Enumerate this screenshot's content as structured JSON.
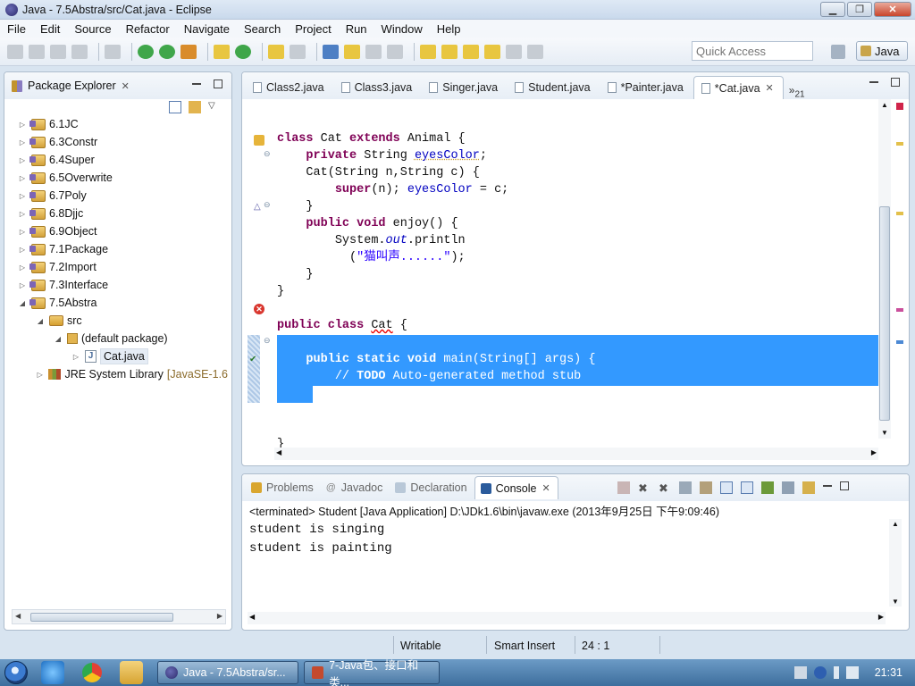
{
  "window": {
    "title": "Java - 7.5Abstra/src/Cat.java - Eclipse"
  },
  "menu": [
    "File",
    "Edit",
    "Source",
    "Refactor",
    "Navigate",
    "Search",
    "Project",
    "Run",
    "Window",
    "Help"
  ],
  "toolbar": {
    "quick_access_placeholder": "Quick Access",
    "perspective": "Java"
  },
  "package_explorer": {
    "title": "Package Explorer",
    "items": [
      {
        "label": "6.1JC",
        "level": 0,
        "type": "project"
      },
      {
        "label": "6.3Constr",
        "level": 0,
        "type": "project"
      },
      {
        "label": "6.4Super",
        "level": 0,
        "type": "project"
      },
      {
        "label": "6.5Overwrite",
        "level": 0,
        "type": "project"
      },
      {
        "label": "6.7Poly",
        "level": 0,
        "type": "project"
      },
      {
        "label": "6.8Djjc",
        "level": 0,
        "type": "project"
      },
      {
        "label": "6.9Object",
        "level": 0,
        "type": "project"
      },
      {
        "label": "7.1Package",
        "level": 0,
        "type": "project"
      },
      {
        "label": "7.2Import",
        "level": 0,
        "type": "project"
      },
      {
        "label": "7.3Interface",
        "level": 0,
        "type": "project"
      },
      {
        "label": "7.5Abstra",
        "level": 0,
        "type": "project",
        "expanded": true
      },
      {
        "label": "src",
        "level": 1,
        "type": "folder",
        "expanded": true
      },
      {
        "label": "(default package)",
        "level": 2,
        "type": "package",
        "expanded": true
      },
      {
        "label": "Cat.java",
        "level": 3,
        "type": "java",
        "selected": true
      },
      {
        "label": "JRE System Library",
        "level": 1,
        "type": "library",
        "suffix": "[JavaSE-1.6"
      }
    ]
  },
  "editor": {
    "tabs": [
      "Class2.java",
      "Class3.java",
      "Singer.java",
      "Student.java",
      "*Painter.java",
      "*Cat.java"
    ],
    "active_tab": "*Cat.java",
    "overflow": "21",
    "code": {
      "l1a": "class ",
      "l1b": "Cat ",
      "l1c": "extends ",
      "l1d": "Animal {",
      "l2a": "private ",
      "l2b": "String ",
      "l2c": "eyesColor",
      "l2d": ";",
      "l3": "Cat(String n,String c) {",
      "l4a": "super",
      "l4b": "(n); ",
      "l4c": "eyesColor",
      "l4d": " = c;",
      "l5": "}",
      "l6a": "public ",
      "l6b": "void ",
      "l6c": "enjoy() {",
      "l7a": "System.",
      "l7b": "out",
      "l7c": ".println",
      "l8a": "(",
      "l8b": "\"猫叫声......\"",
      "l8c": ");",
      "l9": "}",
      "l10": "}",
      "l11a": "public ",
      "l11b": "class ",
      "l11c": "Cat",
      "l11d": " {",
      "l12a": "public ",
      "l12b": "static ",
      "l12c": "void ",
      "l12d": "main(String[] args) {",
      "l13a": "// ",
      "l13b": "TODO",
      "l13c": " Auto-generated method stub",
      "l14": "}",
      "l15": "}"
    }
  },
  "console": {
    "tabs": [
      "Problems",
      "Javadoc",
      "Declaration",
      "Console"
    ],
    "active_tab": "Console",
    "status": "<terminated> Student [Java Application] D:\\JDk1.6\\bin\\javaw.exe (2013年9月25日 下午9:09:46)",
    "output": [
      "student is singing",
      "student is painting"
    ]
  },
  "statusbar": {
    "mode": "Writable",
    "insert": "Smart Insert",
    "position": "24 : 1"
  },
  "taskbar": {
    "tasks": [
      "Java - 7.5Abstra/sr...",
      "7-Java包、接口和类..."
    ],
    "clock": "21:31"
  }
}
